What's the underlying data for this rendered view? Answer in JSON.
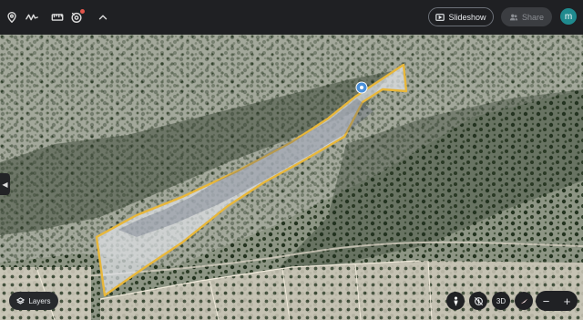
{
  "toolbar": {
    "icons": [
      "location-pin-icon",
      "path-icon",
      "ruler-icon",
      "camera-icon",
      "chevron-up-icon"
    ]
  },
  "header": {
    "slideshow_label": "Slideshow",
    "share_label": "Share",
    "avatar_letter": "m"
  },
  "map": {
    "layers_label": "Layers",
    "view_3d_label": "3D",
    "zoom_out": "−",
    "zoom_in": "+",
    "polygon_color": "#e8b73a",
    "marker_color": "#4a90d9"
  }
}
